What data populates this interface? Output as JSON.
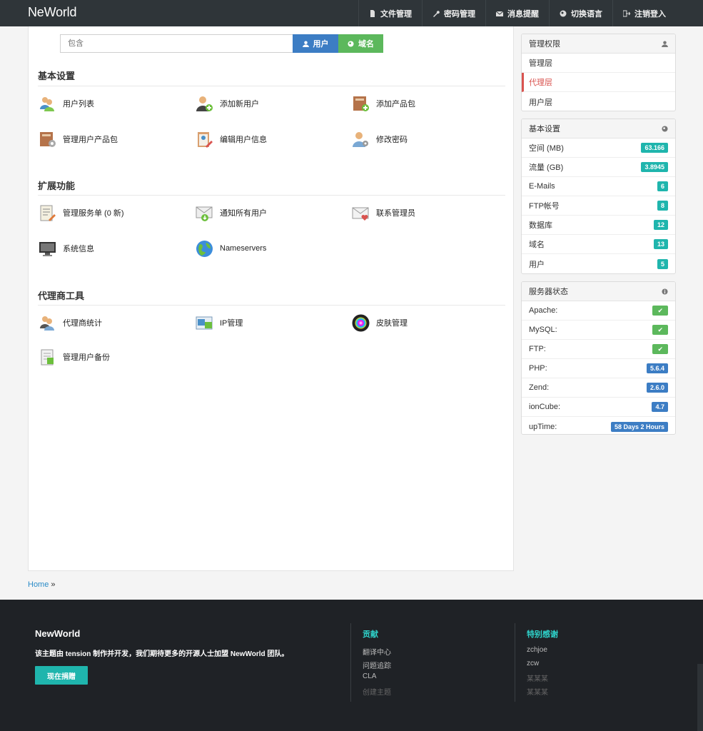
{
  "brand": "NeWorld",
  "nav": [
    {
      "label": "文件管理",
      "icon": "file-icon"
    },
    {
      "label": "密码管理",
      "icon": "wrench-icon"
    },
    {
      "label": "消息提醒",
      "icon": "envelope-icon"
    },
    {
      "label": "切换语言",
      "icon": "globe-icon"
    },
    {
      "label": "注销登入",
      "icon": "logout-icon"
    }
  ],
  "search": {
    "placeholder": "包含",
    "user_btn": "用户",
    "domain_btn": "域名"
  },
  "sections": [
    {
      "title": "基本设置",
      "items": [
        "用户列表",
        "添加新用户",
        "添加产品包",
        "管理用户产品包",
        "编辑用户信息",
        "修改密码"
      ]
    },
    {
      "title": "扩展功能",
      "items": [
        "管理服务单 (0 新)",
        "通知所有用户",
        "联系管理员",
        "系统信息",
        "Nameservers"
      ]
    },
    {
      "title": "代理商工具",
      "items": [
        "代理商统计",
        "IP管理",
        "皮肤管理",
        "管理用户备份"
      ]
    }
  ],
  "panels": {
    "access": {
      "title": "管理权限",
      "rows": [
        "管理层",
        "代理层",
        "用户层"
      ]
    },
    "basic": {
      "title": "基本设置",
      "rows": [
        {
          "label": "空间 (MB)",
          "value": "63.166"
        },
        {
          "label": "流量 (GB)",
          "value": "3.8945"
        },
        {
          "label": "E-Mails",
          "value": "6"
        },
        {
          "label": "FTP帐号",
          "value": "8"
        },
        {
          "label": "数据库",
          "value": "12"
        },
        {
          "label": "域名",
          "value": "13"
        },
        {
          "label": "用户",
          "value": "5"
        }
      ]
    },
    "server": {
      "title": "服务器状态",
      "rows": [
        {
          "label": "Apache:",
          "value": "✔"
        },
        {
          "label": "MySQL:",
          "value": "✔"
        },
        {
          "label": "FTP:",
          "value": "✔"
        },
        {
          "label": "PHP:",
          "value": "5.6.4"
        },
        {
          "label": "Zend:",
          "value": "2.6.0"
        },
        {
          "label": "ionCube:",
          "value": "4.7"
        },
        {
          "label": "upTime:",
          "value": "58 Days 2 Hours"
        }
      ]
    }
  },
  "breadcrumb": {
    "home": "Home",
    "sep": "»"
  },
  "footer": {
    "brand": "NewWorld",
    "desc": "该主题由 tension 制作并开发，我们期待更多的开源人士加盟 NewWorld 团队。",
    "donate": "现在捐赠",
    "col1": {
      "title": "贡献",
      "links": [
        "翻译中心",
        "问题追踪",
        "CLA",
        "创建主题"
      ]
    },
    "col2": {
      "title": "特别感谢",
      "links": [
        "zchjoe",
        "zcw",
        "某某某",
        "某某某"
      ]
    }
  },
  "colors": {
    "accent": "#1fb5ad",
    "blue": "#3c7dc4",
    "green": "#5cb85c",
    "danger": "#d9534f",
    "topbar": "#2f3539"
  }
}
